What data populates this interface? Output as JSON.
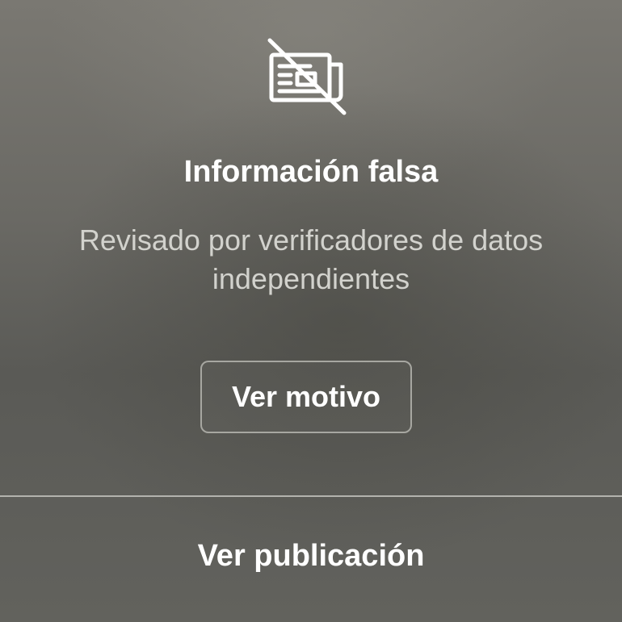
{
  "warning": {
    "icon": "crossed-out-newspaper-icon",
    "title": "Información falsa",
    "subtitle": "Revisado por verificadores de datos independientes",
    "reason_button_label": "Ver motivo"
  },
  "footer": {
    "view_post_label": "Ver publicación"
  },
  "colors": {
    "text_primary": "#ffffff",
    "text_secondary": "#d2d2cd",
    "button_border": "#a7a7a1",
    "divider": "#b3b3ae"
  }
}
